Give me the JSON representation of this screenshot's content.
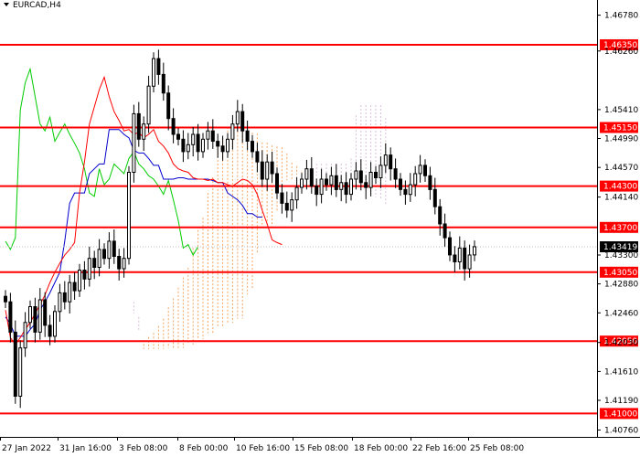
{
  "symbol_label": "EURCAD,H4",
  "colors": {
    "background": "#ffffff",
    "level_line": "#ff0000",
    "level_badge": "#ff0000",
    "price_badge": "#000000",
    "candles": "#000000",
    "tenkan": "#ff0000",
    "kijun": "#0000cc",
    "chikou": "#00cc00",
    "senkou_bull": "#f4a460",
    "senkou_bear": "#d8bfd8",
    "current_line": "#c0c0c0"
  },
  "chart_data": {
    "type": "candlestick",
    "title": "EURCAD,H4",
    "ylim": [
      1.4066,
      1.47
    ],
    "y_ticks": [
      "1.46780",
      "1.46260",
      "1.45410",
      "1.44990",
      "1.44570",
      "1.44140",
      "1.43300",
      "1.42880",
      "1.42460",
      "1.42030",
      "1.41610",
      "1.41190",
      "1.40760"
    ],
    "x_ticks": [
      "27 Jan 2022",
      "31 Jan 16:00",
      "3 Feb 08:00",
      "8 Feb 00:00",
      "10 Feb 16:00",
      "15 Feb 08:00",
      "18 Feb 00:00",
      "22 Feb 16:00",
      "25 Feb 08:00"
    ],
    "horizontal_levels": [
      "1.46350",
      "1.45150",
      "1.44300",
      "1.43700",
      "1.43050",
      "1.42050",
      "1.41000"
    ],
    "current_price": "1.43419",
    "close_series": [
      1.4262,
      1.4218,
      1.4125,
      1.4195,
      1.4232,
      1.4255,
      1.4218,
      1.4265,
      1.4228,
      1.4212,
      1.4248,
      1.4275,
      1.4262,
      1.429,
      1.4278,
      1.4308,
      1.4295,
      1.4325,
      1.4312,
      1.4338,
      1.4325,
      1.435,
      1.4328,
      1.431,
      1.4325,
      1.445,
      1.4535,
      1.4498,
      1.452,
      1.4575,
      1.4615,
      1.4592,
      1.4565,
      1.4528,
      1.4505,
      1.4498,
      1.448,
      1.449,
      1.4505,
      1.448,
      1.4498,
      1.451,
      1.4495,
      1.4488,
      1.448,
      1.4498,
      1.452,
      1.4538,
      1.451,
      1.4495,
      1.448,
      1.4465,
      1.444,
      1.4465,
      1.4448,
      1.442,
      1.4405,
      1.4395,
      1.441,
      1.4428,
      1.444,
      1.4455,
      1.443,
      1.4418,
      1.444,
      1.4432,
      1.4445,
      1.4425,
      1.4435,
      1.4418,
      1.444,
      1.4452,
      1.4435,
      1.4428,
      1.445,
      1.4442,
      1.446,
      1.4475,
      1.4455,
      1.444,
      1.4425,
      1.4418,
      1.4432,
      1.4448,
      1.446,
      1.4445,
      1.4425,
      1.44,
      1.4375,
      1.4355,
      1.433,
      1.432,
      1.434,
      1.431,
      1.433,
      1.4342
    ],
    "tenkan_series": [
      1.425,
      1.421,
      1.42,
      1.421,
      1.4222,
      1.4232,
      1.4245,
      1.4258,
      1.4272,
      1.429,
      1.4305,
      1.4318,
      1.433,
      1.4338,
      1.4348,
      1.442,
      1.4465,
      1.452,
      1.4545,
      1.457,
      1.4588,
      1.456,
      1.4538,
      1.4525,
      1.451,
      1.4512,
      1.4505,
      1.4508,
      1.45,
      1.4505,
      1.4512,
      1.4495,
      1.4488,
      1.4478,
      1.4462,
      1.4455,
      1.4452,
      1.445,
      1.4442,
      1.444,
      1.444,
      1.4438,
      1.444,
      1.4435,
      1.4435,
      1.4432,
      1.443,
      1.4435,
      1.444,
      1.4438,
      1.4432,
      1.4418,
      1.4395,
      1.4375,
      1.4352,
      1.4348,
      1.4345
    ],
    "kijun_series": [
      1.424,
      1.423,
      1.4212,
      1.4212,
      1.4212,
      1.4222,
      1.423,
      1.425,
      1.4262,
      1.4275,
      1.429,
      1.4305,
      1.435,
      1.4405,
      1.442,
      1.442,
      1.442,
      1.4448,
      1.4455,
      1.4462,
      1.4462,
      1.4512,
      1.4512,
      1.4512,
      1.4505,
      1.45,
      1.4482,
      1.4478,
      1.4478,
      1.447,
      1.446,
      1.446,
      1.444,
      1.444,
      1.444,
      1.4442,
      1.4442,
      1.444,
      1.444,
      1.444,
      1.444,
      1.444,
      1.4438,
      1.4435,
      1.4435,
      1.442,
      1.4415,
      1.441,
      1.4402,
      1.439,
      1.439,
      1.4385
    ],
    "chikou_series": [
      1.435,
      1.4338,
      1.4355,
      1.454,
      1.458,
      1.46,
      1.456,
      1.452,
      1.451,
      1.453,
      1.4495,
      1.4508,
      1.452,
      1.4505,
      1.4492,
      1.4478,
      1.4455,
      1.442,
      1.4415,
      1.4455,
      1.4432,
      1.444,
      1.4462,
      1.4455,
      1.4448,
      1.447,
      1.448,
      1.4462,
      1.4455,
      1.4445,
      1.444,
      1.443,
      1.4418,
      1.4438,
      1.441,
      1.438,
      1.434,
      1.4345,
      1.433,
      1.4342
    ]
  }
}
